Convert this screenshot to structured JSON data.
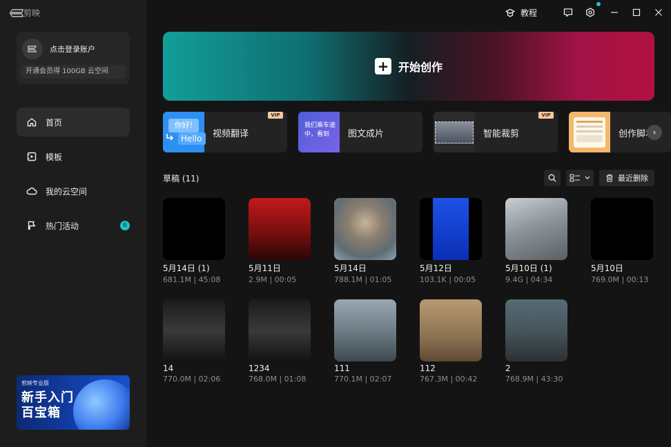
{
  "app": {
    "name": "剪映"
  },
  "sidebar": {
    "login": {
      "title": "点击登录账户",
      "promo": "开通会员得 100GB 云空间"
    },
    "nav": [
      {
        "label": "首页",
        "icon": "home-icon",
        "active": true
      },
      {
        "label": "模板",
        "icon": "template-icon"
      },
      {
        "label": "我的云空间",
        "icon": "cloud-icon"
      },
      {
        "label": "热门活动",
        "icon": "flag-icon",
        "badge": "6"
      }
    ],
    "promo_banner": {
      "brand": "剪映专业版",
      "title_line1": "新手入门",
      "title_line2": "百宝箱"
    }
  },
  "topbar": {
    "tutorial_label": "教程"
  },
  "hero": {
    "label": "开始创作"
  },
  "quick_actions": [
    {
      "label": "视频翻译",
      "vip": "VIP",
      "thumb_text_top": "你好!",
      "thumb_text_bottom": "Hello"
    },
    {
      "label": "图文成片",
      "thumb_text": "我们乘车途中，看到"
    },
    {
      "label": "智能裁剪",
      "vip": "VIP"
    },
    {
      "label": "创作脚本"
    }
  ],
  "drafts": {
    "title": "草稿 (11)",
    "recent_delete": "最近删除",
    "items": [
      {
        "name": "5月14日 (1)",
        "meta": "681.1M | 45:08",
        "thumb": "black"
      },
      {
        "name": "5月11日",
        "meta": "2.9M | 00:05",
        "thumb": "red"
      },
      {
        "name": "5月14日",
        "meta": "788.1M | 01:05",
        "thumb": "portrait"
      },
      {
        "name": "5月12日",
        "meta": "103.1K | 00:05",
        "thumb": "blue"
      },
      {
        "name": "5月10日 (1)",
        "meta": "9.4G | 04:34",
        "thumb": "soldiers"
      },
      {
        "name": "5月10日",
        "meta": "769.0M | 00:13",
        "thumb": "black"
      },
      {
        "name": "14",
        "meta": "770.0M | 02:06",
        "thumb": "night"
      },
      {
        "name": "1234",
        "meta": "768.0M | 01:08",
        "thumb": "night"
      },
      {
        "name": "111",
        "meta": "770.1M | 02:07",
        "thumb": "binoculars"
      },
      {
        "name": "112",
        "meta": "767.3M | 00:42",
        "thumb": "sepia"
      },
      {
        "name": "2",
        "meta": "768.9M | 43:30",
        "thumb": "battle"
      }
    ]
  },
  "colors": {
    "accent_teal": "#18c3c6",
    "hero_left": "#139e99",
    "hero_right": "#b0123f",
    "vip_tag": "#f1c9a1"
  }
}
